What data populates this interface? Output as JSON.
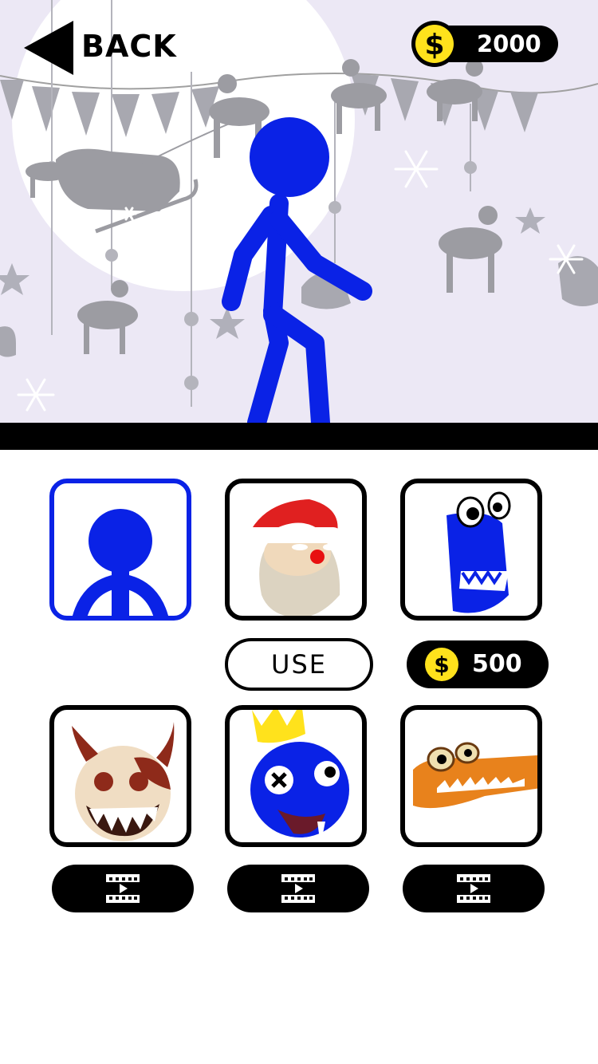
{
  "header": {
    "back_label": "BACK",
    "coins": "2000",
    "currency_symbol": "$"
  },
  "colors": {
    "accent_blue": "#0a22e6",
    "coin_yellow": "#ffe21c",
    "scene_bg": "#ece8f5"
  },
  "skins": [
    {
      "name": "stickman-blue",
      "icon": "stickman-icon",
      "state": "selected"
    },
    {
      "name": "santa",
      "icon": "santa-icon",
      "action": "use",
      "action_label": "USE"
    },
    {
      "name": "blue-worm-monster",
      "icon": "blue-monster-icon",
      "action": "buy",
      "price": "500"
    },
    {
      "name": "devil-doll",
      "icon": "devil-face-icon",
      "action": "watch-video"
    },
    {
      "name": "blue-king",
      "icon": "blue-king-icon",
      "action": "watch-video"
    },
    {
      "name": "orange-croc",
      "icon": "crocodile-icon",
      "action": "watch-video"
    }
  ],
  "icons": {
    "video": "video-film-icon",
    "back": "back-arrow-icon",
    "coin": "dollar-coin-icon"
  }
}
